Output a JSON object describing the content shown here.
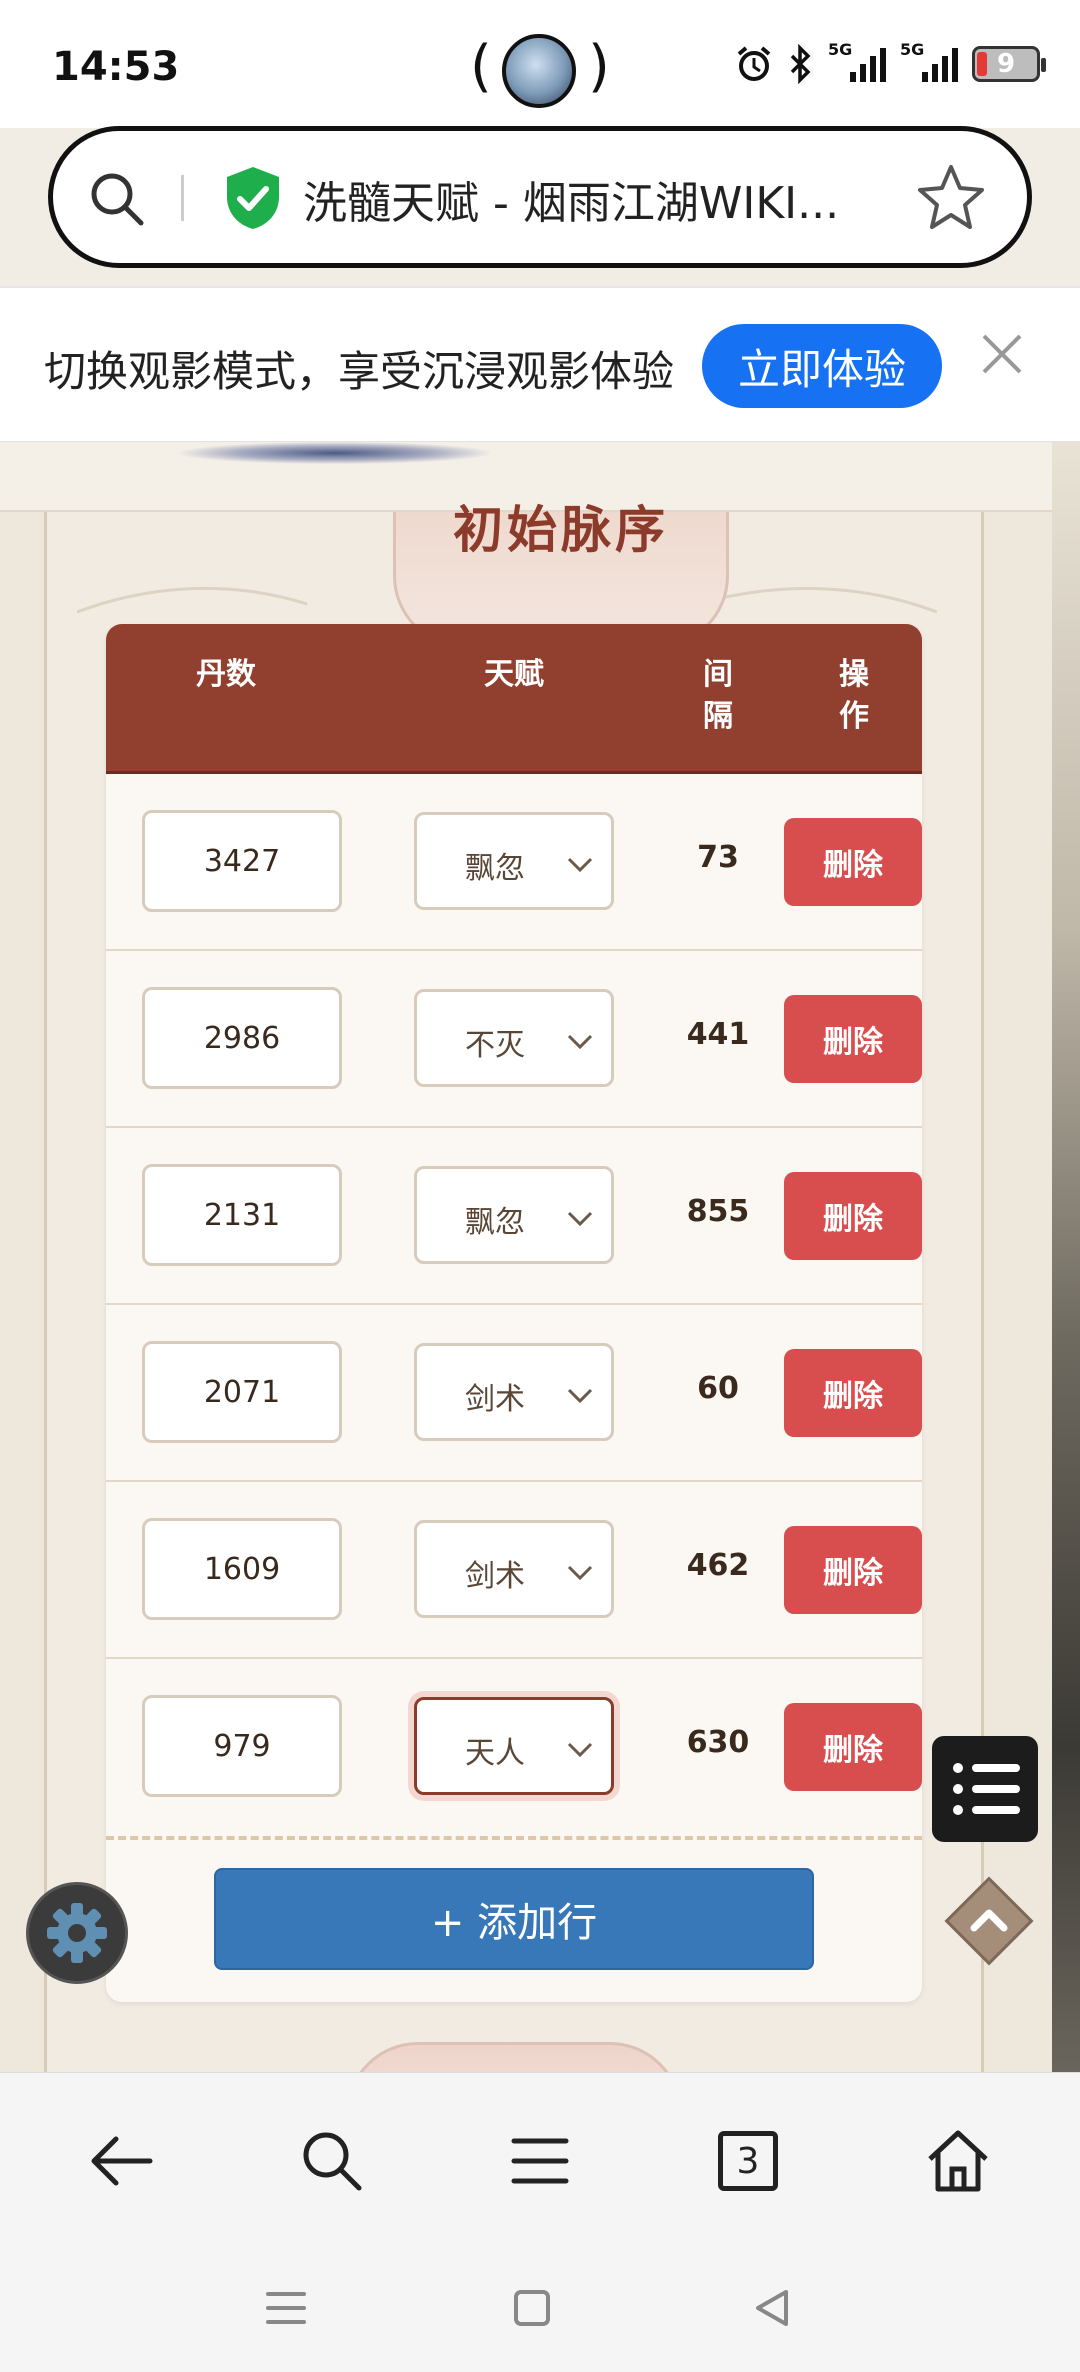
{
  "status_bar": {
    "time": "14:53",
    "battery": "9",
    "network_1": "5G",
    "network_2": "5G",
    "icons": [
      "alarm-icon",
      "bluetooth-icon",
      "signal-icon",
      "signal-icon",
      "battery-icon"
    ]
  },
  "browser": {
    "page_title": "洗髓天赋 - 烟雨江湖WIKI...",
    "icons": [
      "search-icon",
      "shield-check-icon",
      "star-icon"
    ]
  },
  "promo": {
    "text": "切换观影模式，享受沉浸观影体验",
    "button": "立即体验",
    "close_icon": "close-icon"
  },
  "section": {
    "title": "初始脉序"
  },
  "table": {
    "headers": {
      "dan": "丹数",
      "talent": "天赋",
      "gap": "间\n隔",
      "op": "操\n作"
    },
    "rows": [
      {
        "dan": "3427",
        "talent": "飘忽",
        "gap": "73",
        "delete": "删除"
      },
      {
        "dan": "2986",
        "talent": "不灭",
        "gap": "441",
        "delete": "删除"
      },
      {
        "dan": "2131",
        "talent": "飘忽",
        "gap": "855",
        "delete": "删除"
      },
      {
        "dan": "2071",
        "talent": "剑术",
        "gap": "60",
        "delete": "删除"
      },
      {
        "dan": "1609",
        "talent": "剑术",
        "gap": "462",
        "delete": "删除"
      },
      {
        "dan": "979",
        "talent": "天人",
        "gap": "630",
        "delete": "删除"
      }
    ],
    "add_button": "+ 添加行"
  },
  "floating": [
    "menu-list-icon",
    "gear-icon",
    "chevron-up-icon"
  ],
  "bottom_nav": {
    "tab_count": "3",
    "items": [
      "back-arrow-icon",
      "search-icon",
      "menu-icon",
      "tabs-icon",
      "home-icon"
    ]
  },
  "gesture_nav": [
    "recent-apps-icon",
    "home-square-icon",
    "back-triangle-icon"
  ],
  "colors": {
    "header_red": "#913f2e",
    "delete_red": "#d84e4e",
    "add_blue": "#3878b8",
    "promo_blue": "#1672f3"
  }
}
